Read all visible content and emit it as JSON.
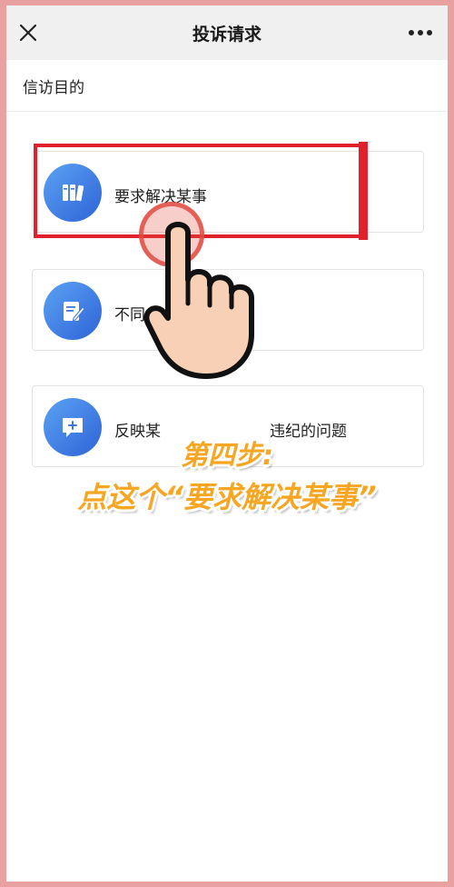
{
  "nav": {
    "title": "投诉请求",
    "close_icon": "close-icon",
    "more_icon": "more-icon"
  },
  "section": {
    "label": "信访目的"
  },
  "options": [
    {
      "label": "要求解决某事",
      "icon": "books-icon"
    },
    {
      "label": "不同",
      "icon": "edit-note-icon"
    },
    {
      "label": "反映某",
      "icon": "chat-add-icon",
      "label_tail": "违纪的问题"
    }
  ],
  "overlay": {
    "step_title": "第四步:",
    "step_instruction": "点这个“要求解决某事”"
  },
  "colors": {
    "highlight": "#e0202a",
    "icon_gradient_start": "#5aa2f2",
    "icon_gradient_end": "#2f63d8",
    "caption": "#f6a623",
    "frame_border": "#e9a0a0"
  }
}
